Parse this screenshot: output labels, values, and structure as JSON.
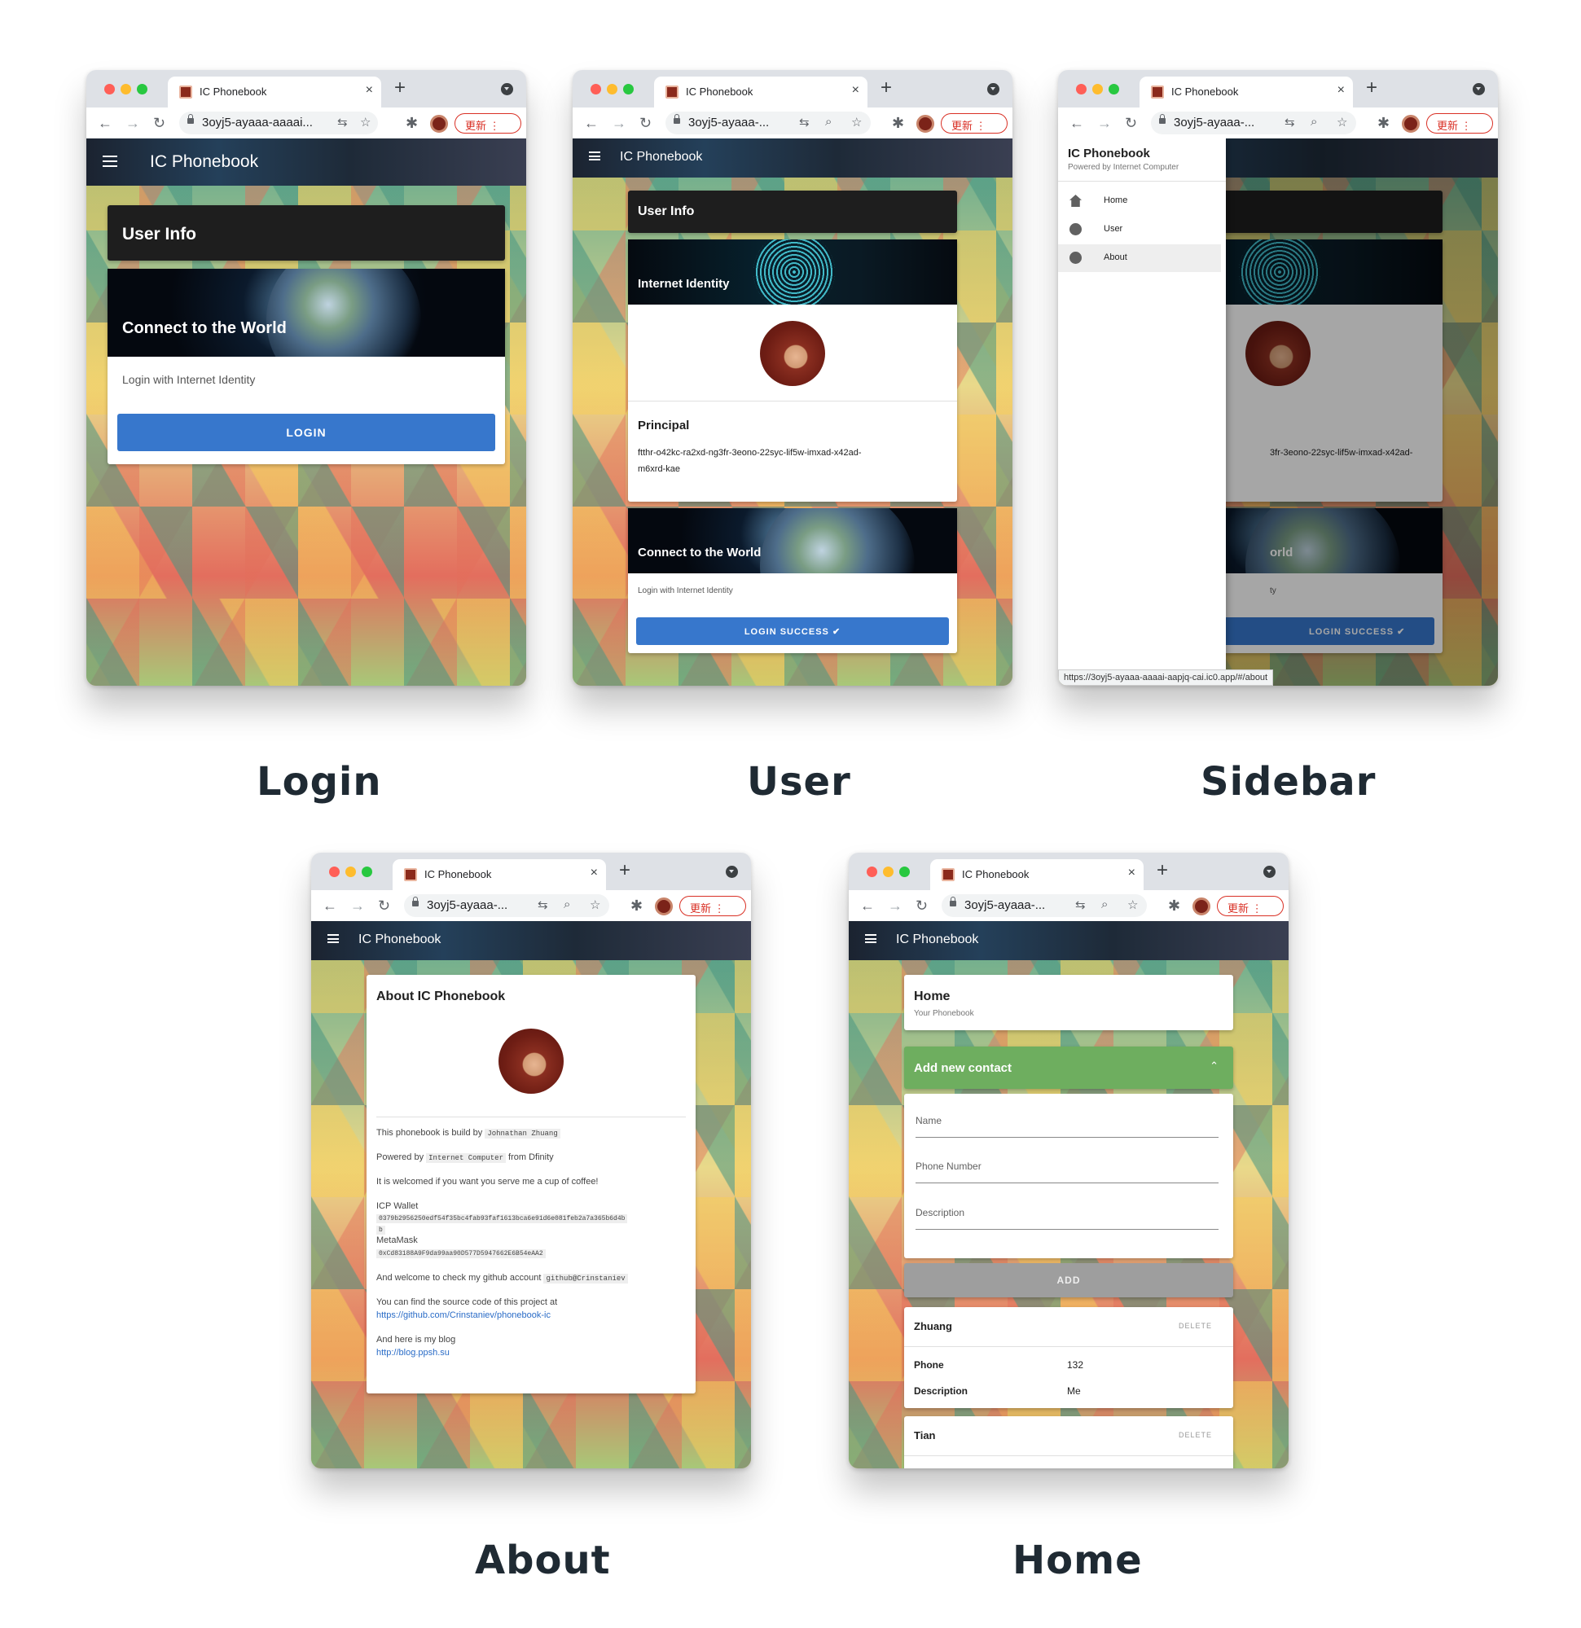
{
  "browser": {
    "tab_title": "IC Phonebook",
    "tab_close": "×",
    "new_tab": "+",
    "url_long": "3oyj5-ayaaa-aaaai...",
    "url_short": "3oyj5-ayaaa-...",
    "update_label": "更新 ⋮"
  },
  "app": {
    "title": "IC Phonebook"
  },
  "login": {
    "caption": "Login",
    "user_info": "User Info",
    "hero_title": "Connect to the World",
    "subtitle": "Login with Internet Identity",
    "button": "LOGIN"
  },
  "user": {
    "caption": "User",
    "user_info": "User Info",
    "identity_title": "Internet Identity",
    "principal_label": "Principal",
    "principal_line1": "ftthr-o42kc-ra2xd-ng3fr-3eono-22syc-lif5w-imxad-x42ad-",
    "principal_line2": "m6xrd-kae",
    "hero_title": "Connect to the World",
    "subtitle": "Login with Internet Identity",
    "button": "LOGIN SUCCESS"
  },
  "sidebar": {
    "caption": "Sidebar",
    "title": "IC Phonebook",
    "subtitle": "Powered by Internet Computer",
    "items": [
      {
        "label": "Home",
        "icon": "home-icon"
      },
      {
        "label": "User",
        "icon": "account-circle-icon"
      },
      {
        "label": "About",
        "icon": "info-icon"
      }
    ],
    "partial_principal": "3fr-3eono-22syc-lif5w-imxad-x42ad-",
    "partial_hero": "orld",
    "partial_sub": "ty",
    "partial_button": "LOGIN SUCCESS",
    "status_url": "https://3oyj5-ayaaa-aaaai-aapjq-cai.ic0.app/#/about"
  },
  "about": {
    "caption": "About",
    "title": "About IC Phonebook",
    "line1_text": "This phonebook is build by",
    "line1_code": "Johnathan Zhuang",
    "line2_text": "Powered by",
    "line2_code": "Internet Computer",
    "line2_tail": "from Dfinity",
    "line3": "It is welcomed if you want you serve me a cup of coffee!",
    "icp_label": "ICP Wallet",
    "icp_address": "0379b2956250edf54f35bc4fab93faf1613bca6e91d6e081feb2a7a365b6d4b",
    "icp_wrap": "b",
    "metamask_label": "MetaMask",
    "metamask_address": "0xCd83188A9F9da99aa90D577D5947662E6B54eAA2",
    "github_text": "And welcome to check my github account",
    "github_code": "github@Crinstaniev",
    "source_text": "You can find the source code of this project at",
    "source_link": "https://github.com/Crinstaniev/phonebook-ic",
    "blog_text": "And here is my blog",
    "blog_link": "http://blog.ppsh.su"
  },
  "home": {
    "caption": "Home",
    "title": "Home",
    "subtitle": "Your Phonebook",
    "add_header": "Add new contact",
    "fields": {
      "name": "Name",
      "phone": "Phone Number",
      "description": "Description"
    },
    "add_button": "ADD",
    "delete_label": "DELETE",
    "contacts": [
      {
        "name": "Zhuang",
        "phone_label": "Phone",
        "phone": "132",
        "desc_label": "Description",
        "desc": "Me"
      },
      {
        "name": "Tian"
      }
    ]
  },
  "colors": {
    "accent_blue": "#3777cc",
    "header_dark": "#1e1e1e",
    "home_green": "#6eae5f",
    "add_gray": "#9e9e9e",
    "update_red": "#d93025"
  }
}
